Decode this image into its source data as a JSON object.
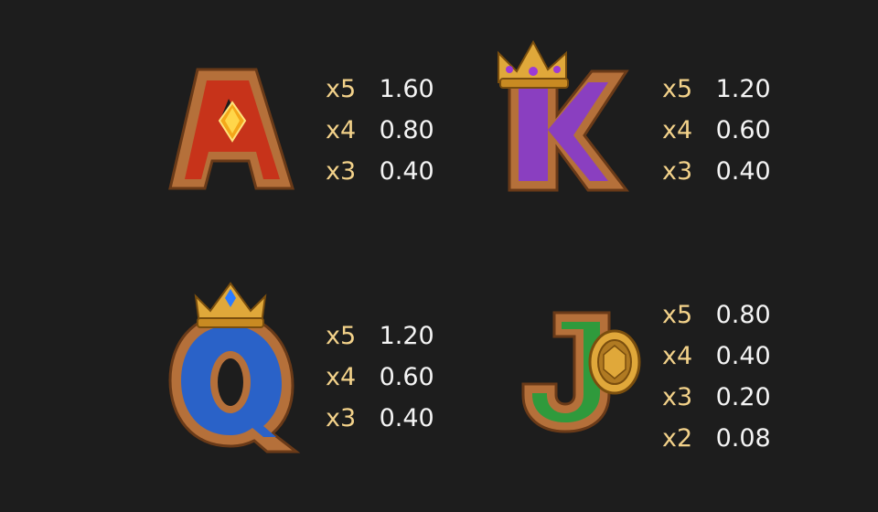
{
  "paytable": {
    "A": {
      "symbol": "letter-a-with-gem-icon",
      "color": "#c7331a",
      "rows": [
        {
          "mult": "x5",
          "value": "1.60"
        },
        {
          "mult": "x4",
          "value": "0.80"
        },
        {
          "mult": "x3",
          "value": "0.40"
        }
      ]
    },
    "K": {
      "symbol": "letter-k-with-crown-icon",
      "color": "#8a3fc0",
      "rows": [
        {
          "mult": "x5",
          "value": "1.20"
        },
        {
          "mult": "x4",
          "value": "0.60"
        },
        {
          "mult": "x3",
          "value": "0.40"
        }
      ]
    },
    "Q": {
      "symbol": "letter-q-with-crown-icon",
      "color": "#2a62c8",
      "rows": [
        {
          "mult": "x5",
          "value": "1.20"
        },
        {
          "mult": "x4",
          "value": "0.60"
        },
        {
          "mult": "x3",
          "value": "0.40"
        }
      ]
    },
    "J": {
      "symbol": "letter-j-with-shield-icon",
      "color": "#2f9a3c",
      "rows": [
        {
          "mult": "x5",
          "value": "0.80"
        },
        {
          "mult": "x4",
          "value": "0.40"
        },
        {
          "mult": "x3",
          "value": "0.20"
        },
        {
          "mult": "x2",
          "value": "0.08"
        }
      ]
    }
  },
  "colors": {
    "background": "#1d1d1d",
    "multiplier_text": "#f3d28a",
    "value_text": "#f4f4f4",
    "wood_frame": "#b5703a",
    "gold": "#e0a83a"
  }
}
